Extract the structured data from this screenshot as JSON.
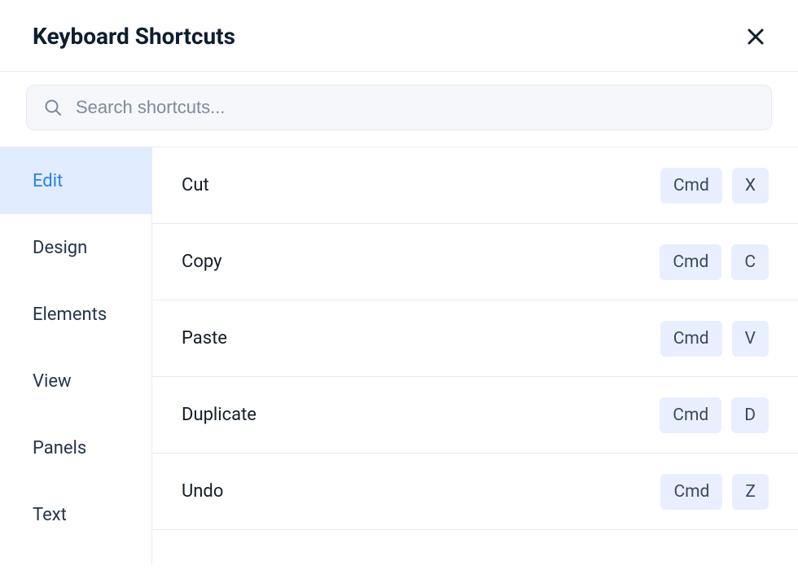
{
  "header": {
    "title": "Keyboard Shortcuts"
  },
  "search": {
    "placeholder": "Search shortcuts..."
  },
  "sidebar": {
    "tabs": [
      {
        "label": "Edit",
        "active": true
      },
      {
        "label": "Design",
        "active": false
      },
      {
        "label": "Elements",
        "active": false
      },
      {
        "label": "View",
        "active": false
      },
      {
        "label": "Panels",
        "active": false
      },
      {
        "label": "Text",
        "active": false
      }
    ]
  },
  "shortcuts": [
    {
      "label": "Cut",
      "keys": [
        "Cmd",
        "X"
      ]
    },
    {
      "label": "Copy",
      "keys": [
        "Cmd",
        "C"
      ]
    },
    {
      "label": "Paste",
      "keys": [
        "Cmd",
        "V"
      ]
    },
    {
      "label": "Duplicate",
      "keys": [
        "Cmd",
        "D"
      ]
    },
    {
      "label": "Undo",
      "keys": [
        "Cmd",
        "Z"
      ]
    }
  ]
}
